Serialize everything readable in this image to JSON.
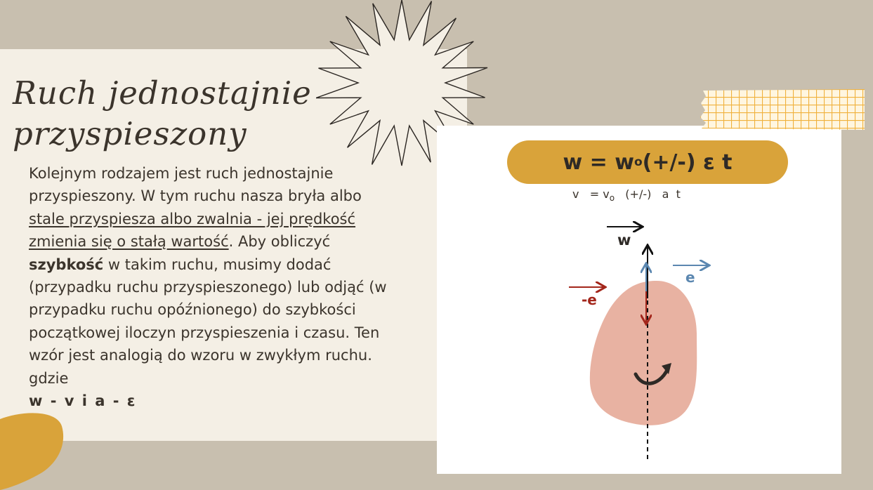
{
  "title": {
    "line1": "Ruch jednostajnie",
    "line2": "przyspieszony"
  },
  "body": {
    "p1": "Kolejnym rodzajem jest ruch jednostajnie przyspieszony. W tym ruchu nasza bryła albo ",
    "underlined": "stale przyspiesza albo zwalnia - jej prędkość zmienia się o stałą wartość",
    "p2": ". Aby obliczyć ",
    "bold": "szybkość",
    "p3": " w takim ruchu, musimy dodać (przypadku ruchu przyspieszonego) lub odjąć (w przypadku ruchu opóźnionego) do szybkości początkowej iloczyn przyspieszenia i czasu. Ten wzór jest analogią do wzoru w zwykłym ruchu. gdzie",
    "symbols": "w - v i a - ε"
  },
  "formula": {
    "lhs": "w = w",
    "sub": "o",
    "rhs": "(+/-) ε t"
  },
  "formula_linear": {
    "lhs": "v   = v",
    "sub": "o",
    "rhs": "   (+/-)   a  t"
  },
  "diagram": {
    "label_w": "w",
    "label_e": "e",
    "label_neg_e": "-e"
  },
  "colors": {
    "background": "#c8bfaf",
    "paper": "#f4efe5",
    "accent_mustard": "#d9a33a",
    "blob_pink": "#e8b2a2",
    "arrow_red": "#a3261b",
    "arrow_blue": "#5b87b0",
    "text_dark": "#3b342c"
  }
}
